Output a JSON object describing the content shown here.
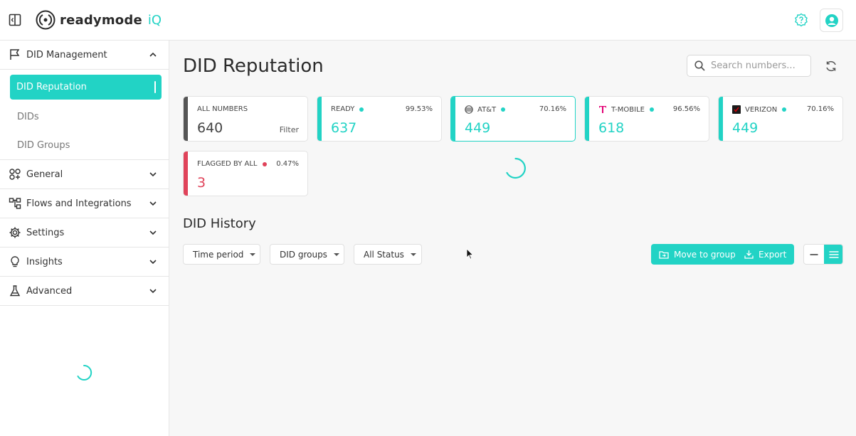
{
  "app": {
    "logo_text": "readymode",
    "logo_suffix": "iQ"
  },
  "colors": {
    "accent": "#22d3c5",
    "flagged": "#e0435a",
    "neutral_accent": "#555555"
  },
  "sidebar": {
    "groups": [
      {
        "label": "DID Management",
        "icon": "flag-icon",
        "expanded": true,
        "items": [
          {
            "label": "DID Reputation",
            "active": true
          },
          {
            "label": "DIDs",
            "active": false
          },
          {
            "label": "DID Groups",
            "active": false
          }
        ]
      },
      {
        "label": "General",
        "icon": "shapes-icon",
        "expanded": false
      },
      {
        "label": "Flows and Integrations",
        "icon": "flow-icon",
        "expanded": false
      },
      {
        "label": "Settings",
        "icon": "gear-icon",
        "expanded": false
      },
      {
        "label": "Insights",
        "icon": "bulb-icon",
        "expanded": false
      },
      {
        "label": "Advanced",
        "icon": "flask-icon",
        "expanded": false
      }
    ]
  },
  "main": {
    "title": "DID Reputation",
    "search": {
      "placeholder": "Search numbers...",
      "value": ""
    },
    "cards": {
      "all": {
        "label": "ALL NUMBERS",
        "value": "640",
        "filter": "Filter"
      },
      "ready": {
        "label": "READY",
        "pct": "99.53%",
        "value": "637"
      },
      "att": {
        "label": "AT&T",
        "pct": "70.16%",
        "value": "449"
      },
      "tmobile": {
        "label": "T-MOBILE",
        "pct": "96.56%",
        "value": "618"
      },
      "verizon": {
        "label": "VERIZON",
        "pct": "70.16%",
        "value": "449"
      },
      "flagged": {
        "label": "FLAGGED BY ALL",
        "pct": "0.47%",
        "value": "3"
      }
    },
    "history": {
      "title": "DID History",
      "filters": {
        "time_period": "Time period",
        "did_groups": "DID groups",
        "status": "All Status"
      },
      "actions": {
        "move_to_group": "Move to group",
        "export": "Export"
      }
    }
  }
}
